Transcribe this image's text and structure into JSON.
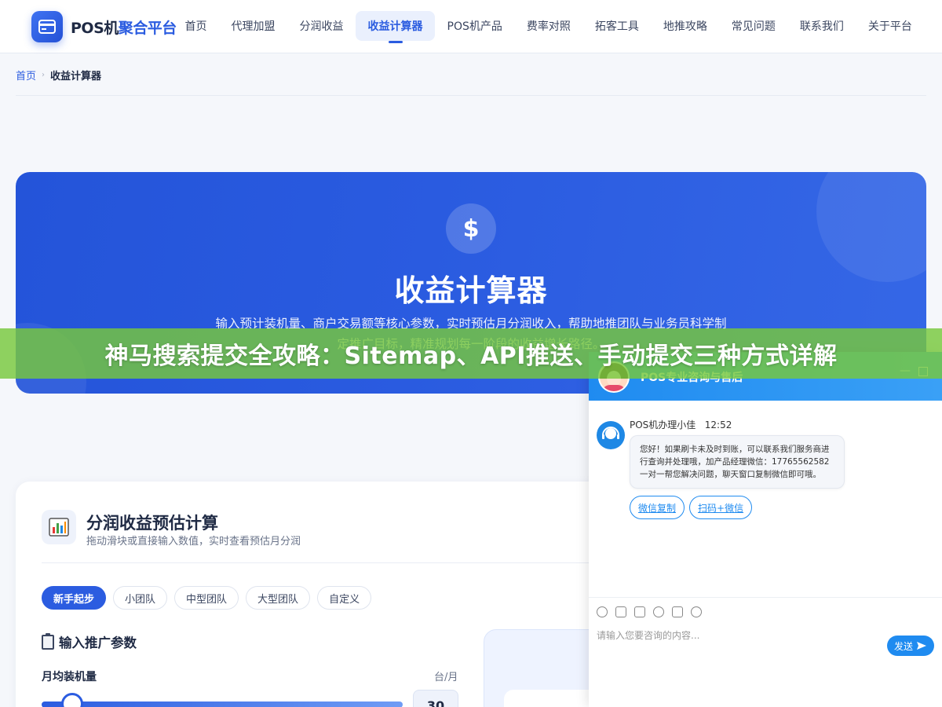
{
  "header": {
    "logo_a": "POS机",
    "logo_b": "聚合平台",
    "nav": [
      {
        "label": "首页"
      },
      {
        "label": "代理加盟"
      },
      {
        "label": "分润收益"
      },
      {
        "label": "收益计算器",
        "active": true
      },
      {
        "label": "POS机产品"
      },
      {
        "label": "费率对照"
      },
      {
        "label": "拓客工具"
      },
      {
        "label": "地推攻略"
      },
      {
        "label": "常见问题"
      },
      {
        "label": "联系我们"
      },
      {
        "label": "关于平台"
      }
    ]
  },
  "breadcrumb": {
    "home": "首页",
    "current": "收益计算器"
  },
  "hero": {
    "icon": "$",
    "title": "收益计算器",
    "description": "输入预计装机量、商户交易额等核心参数，实时预估月分润收入，帮助地推团队与业务员科学制定推广目标，精准规划每一阶段的收益增长路径。"
  },
  "banner": {
    "text": "神马搜索提交全攻略：Sitemap、API推送、手动提交三种方式详解"
  },
  "calculator": {
    "title": "分润收益预估计算",
    "subtitle": "拖动滑块或直接输入数值，实时查看预估月分润",
    "presets": [
      {
        "label": "新手起步",
        "active": true
      },
      {
        "label": "小团队"
      },
      {
        "label": "中型团队"
      },
      {
        "label": "大型团队"
      },
      {
        "label": "自定义"
      }
    ],
    "section_title": "输入推广参数",
    "field_label": "月均装机量",
    "field_unit": "台/月",
    "field_value": "30"
  },
  "chat": {
    "title": "POS专业咨询与售后",
    "agent_name": "POS机办理小佳",
    "time": "12:52",
    "message": "您好！如果刷卡未及时到账，可以联系我们服务商进行查询并处理哦，加产品经理微信：17765562582 一对一帮您解决问题，聊天窗口复制微信即可哦。",
    "buttons": [
      "微信复制",
      "扫码+微信"
    ],
    "input_placeholder": "请输入您要咨询的内容...",
    "send_label": "发送",
    "min_label": "—"
  },
  "colors": {
    "primary": "#2b5ce0",
    "chat": "#1f8bf0",
    "banner": "#78c83c"
  }
}
